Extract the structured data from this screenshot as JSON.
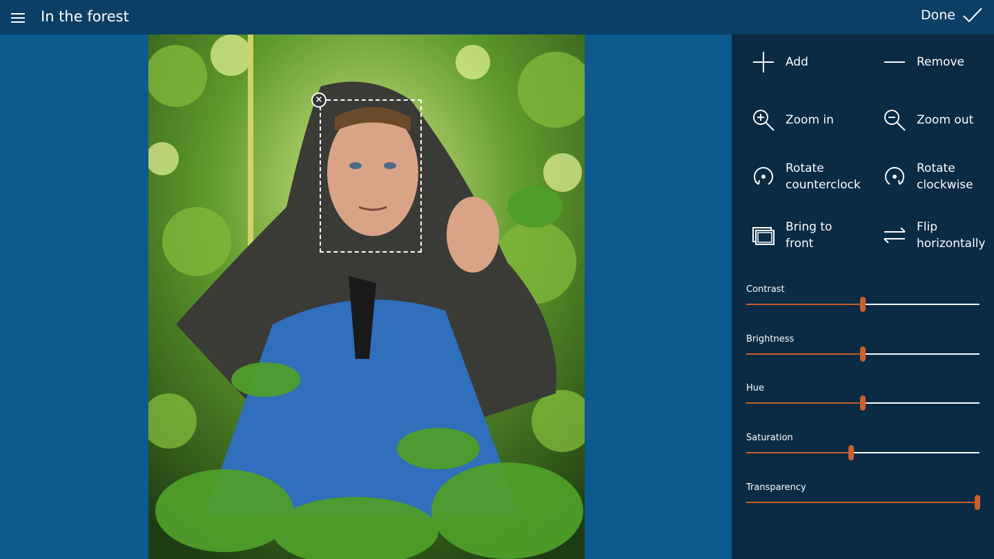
{
  "header": {
    "title": "In the forest",
    "done_label": "Done"
  },
  "tools": [
    {
      "name": "add-button",
      "icon": "plus-icon",
      "label": "Add"
    },
    {
      "name": "remove-button",
      "icon": "minus-icon",
      "label": "Remove"
    },
    {
      "name": "zoom-in-button",
      "icon": "zoom-in-icon",
      "label": "Zoom in"
    },
    {
      "name": "zoom-out-button",
      "icon": "zoom-out-icon",
      "label": "Zoom out"
    },
    {
      "name": "rotate-counterclock-button",
      "icon": "rotate-counterclockwise-icon",
      "label": "Rotate counterclock"
    },
    {
      "name": "rotate-clockwise-button",
      "icon": "rotate-clockwise-icon",
      "label": "Rotate clockwise"
    },
    {
      "name": "bring-to-front-button",
      "icon": "bring-to-front-icon",
      "label": "Bring to front"
    },
    {
      "name": "flip-horizontally-button",
      "icon": "flip-horizontal-icon",
      "label": "Flip horizontally"
    }
  ],
  "sliders": [
    {
      "label": "Contrast",
      "value": 0.5
    },
    {
      "label": "Brightness",
      "value": 0.5
    },
    {
      "label": "Hue",
      "value": 0.5
    },
    {
      "label": "Saturation",
      "value": 0.45
    },
    {
      "label": "Transparency",
      "value": 0.99
    }
  ],
  "colors": {
    "accent": "#c8602a",
    "titlebar": "#0b3f66",
    "panel": "#0b2a44",
    "canvas": "#0d5a8e"
  }
}
